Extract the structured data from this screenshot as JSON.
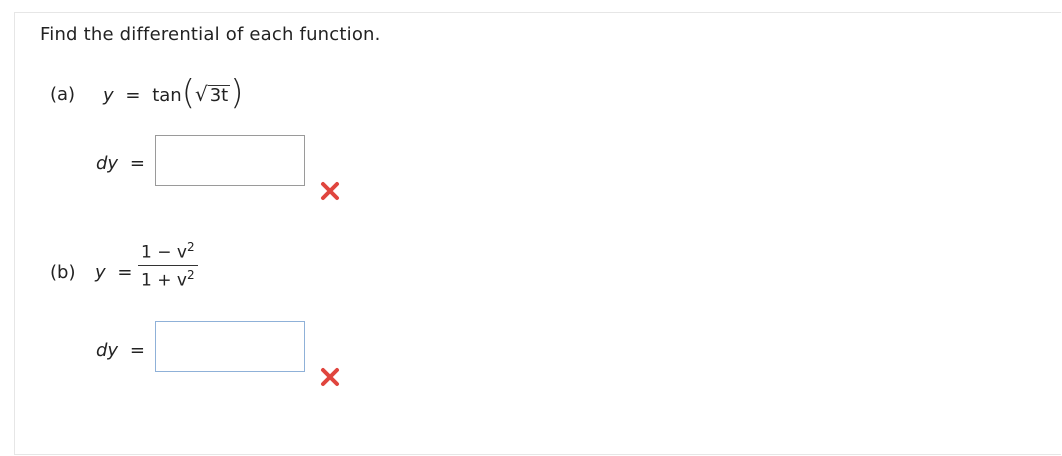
{
  "instruction": "Find the differential of each function.",
  "part_a": {
    "label": "(a)",
    "lhs": "y",
    "equals": "=",
    "func": "tan",
    "open_paren": "(",
    "sqrt_symbol": "√",
    "radicand": "3t",
    "close_paren": ")",
    "dy_label": "dy",
    "dy_equals": "=",
    "answer_value": "",
    "status": "incorrect"
  },
  "part_b": {
    "label": "(b)",
    "lhs": "y",
    "equals": "=",
    "numerator": "1 − v",
    "numerator_exp": "2",
    "denominator": "1 + v",
    "denominator_exp": "2",
    "dy_label": "dy",
    "dy_equals": "=",
    "answer_value": "",
    "status": "incorrect"
  },
  "icons": {
    "wrong": "close-x-icon"
  },
  "colors": {
    "wrong_mark": "#e0453e",
    "box_border": "#9a9a9a",
    "box_border_focus": "#8fb1d8"
  }
}
